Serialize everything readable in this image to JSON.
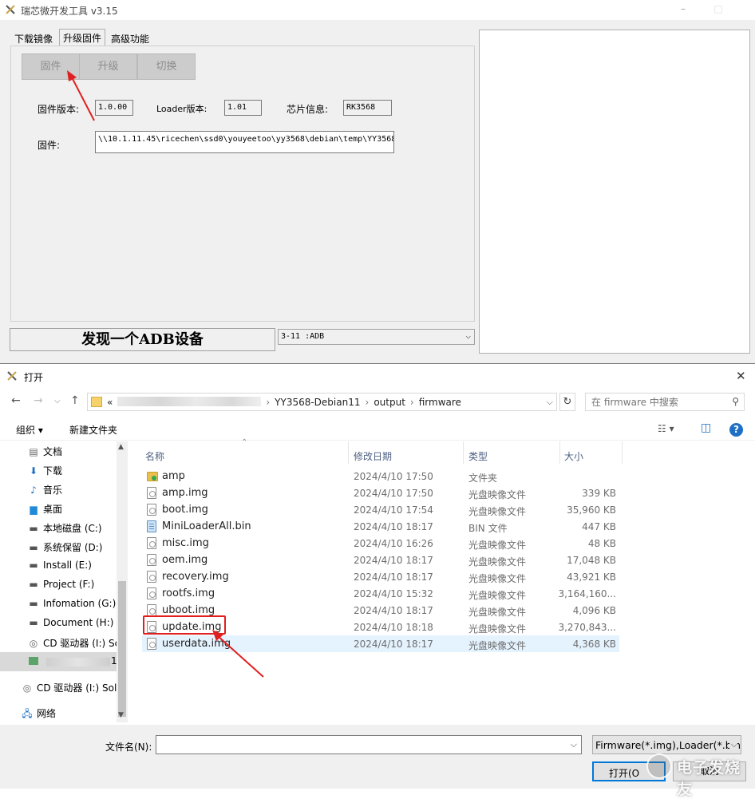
{
  "tool": {
    "title": "瑞芯微开发工具 v3.15",
    "tabs": [
      "下载镜像",
      "升级固件",
      "高级功能"
    ],
    "buttons": {
      "firmware": "固件",
      "upgrade": "升级",
      "switch": "切换"
    },
    "fields": {
      "fw_version_label": "固件版本:",
      "fw_version": "1.0.00",
      "loader_version_label": "Loader版本:",
      "loader_version": "1.01",
      "chip_label": "芯片信息:",
      "chip": "RK3568",
      "firmware_label": "固件:",
      "firmware_path": "\\\\10.1.11.45\\ricechen\\ssd0\\youyeetoo\\yy3568\\debian\\temp\\YY3568"
    },
    "status": "发现一个ADB设备",
    "device": "3-11 :ADB"
  },
  "dialog": {
    "title": "打开",
    "breadcrumb": [
      "«",
      "YY3568-Debian11",
      "output",
      "firmware"
    ],
    "search_placeholder": "在 firmware 中搜索",
    "toolbar": {
      "organize": "组织 ▾",
      "new_folder": "新建文件夹"
    },
    "nav_items": [
      {
        "label": "文档",
        "icon": "document-icon"
      },
      {
        "label": "下载",
        "icon": "download-icon"
      },
      {
        "label": "音乐",
        "icon": "music-icon"
      },
      {
        "label": "桌面",
        "icon": "desktop-icon"
      },
      {
        "label": "本地磁盘 (C:)",
        "icon": "drive-icon"
      },
      {
        "label": "系统保留 (D:)",
        "icon": "drive-icon"
      },
      {
        "label": "Install (E:)",
        "icon": "drive-icon"
      },
      {
        "label": "Project (F:)",
        "icon": "drive-icon"
      },
      {
        "label": "Infomation (G:)",
        "icon": "drive-icon"
      },
      {
        "label": "Document (H:)",
        "icon": "drive-icon"
      },
      {
        "label": "CD 驱动器 (I:) Sc",
        "icon": "cd-icon"
      },
      {
        "label": "1",
        "icon": "network-drive-icon"
      },
      {
        "label": "CD 驱动器 (I:) Sol",
        "icon": "cd-icon"
      },
      {
        "label": "网络",
        "icon": "network-icon"
      }
    ],
    "columns": {
      "name": "名称",
      "date": "修改日期",
      "type": "类型",
      "size": "大小"
    },
    "files": [
      {
        "name": "amp",
        "date": "2024/4/10 17:50",
        "type": "文件夹",
        "size": "",
        "icon": "folder"
      },
      {
        "name": "amp.img",
        "date": "2024/4/10 17:50",
        "type": "光盘映像文件",
        "size": "339 KB",
        "icon": "img"
      },
      {
        "name": "boot.img",
        "date": "2024/4/10 17:54",
        "type": "光盘映像文件",
        "size": "35,960 KB",
        "icon": "img"
      },
      {
        "name": "MiniLoaderAll.bin",
        "date": "2024/4/10 18:17",
        "type": "BIN 文件",
        "size": "447 KB",
        "icon": "bin"
      },
      {
        "name": "misc.img",
        "date": "2024/4/10 16:26",
        "type": "光盘映像文件",
        "size": "48 KB",
        "icon": "img"
      },
      {
        "name": "oem.img",
        "date": "2024/4/10 18:17",
        "type": "光盘映像文件",
        "size": "17,048 KB",
        "icon": "img"
      },
      {
        "name": "recovery.img",
        "date": "2024/4/10 18:17",
        "type": "光盘映像文件",
        "size": "43,921 KB",
        "icon": "img"
      },
      {
        "name": "rootfs.img",
        "date": "2024/4/10 15:32",
        "type": "光盘映像文件",
        "size": "3,164,160...",
        "icon": "img"
      },
      {
        "name": "uboot.img",
        "date": "2024/4/10 18:17",
        "type": "光盘映像文件",
        "size": "4,096 KB",
        "icon": "img"
      },
      {
        "name": "update.img",
        "date": "2024/4/10 18:18",
        "type": "光盘映像文件",
        "size": "3,270,843...",
        "icon": "img"
      },
      {
        "name": "userdata.img",
        "date": "2024/4/10 18:17",
        "type": "光盘映像文件",
        "size": "4,368 KB",
        "icon": "img"
      }
    ],
    "selected_file": "userdata.img",
    "filename_label": "文件名(N):",
    "filename_value": "",
    "filter": "Firmware(*.img),Loader(*.bin",
    "open_label": "打开(O",
    "cancel_label": "取消"
  },
  "watermark": "电子发烧友",
  "colors": {
    "annotation_red": "#e02020",
    "selection": "#e5f3ff",
    "accent": "#0078d7"
  }
}
